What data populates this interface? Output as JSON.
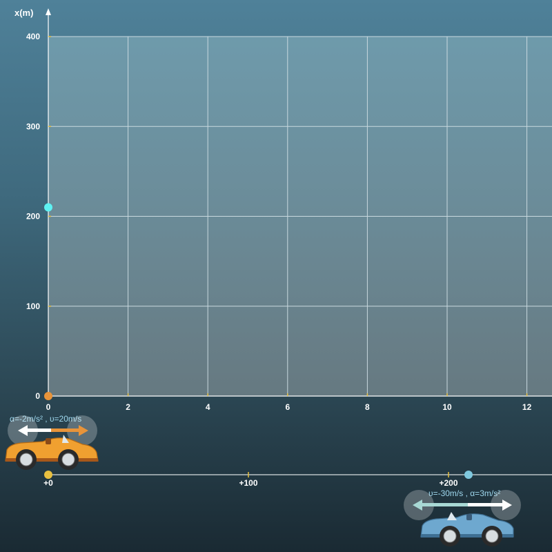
{
  "chart_data": {
    "type": "line",
    "ylabel": "x(m)",
    "xlabel": "",
    "xlim": [
      0,
      12
    ],
    "ylim": [
      0,
      400
    ],
    "x_ticks": [
      "0",
      "2",
      "4",
      "6",
      "8",
      "10",
      "12"
    ],
    "y_ticks": [
      "0",
      "100",
      "200",
      "300",
      "400"
    ],
    "series": [
      {
        "color": "#e8943a",
        "points": [
          [
            0,
            0
          ]
        ]
      },
      {
        "color": "#5ef2f2",
        "points": [
          [
            0,
            210
          ]
        ]
      }
    ]
  },
  "track": {
    "ticks": [
      "+0",
      "+100",
      "+200"
    ]
  },
  "cars": [
    {
      "params_label": "α=-2m/s² , υ=20m/s",
      "color": "#f0a030",
      "marker_color": "#e8c040",
      "position": 0
    },
    {
      "params_label": "υ=-30m/s , α=3m/s²",
      "color": "#6ea8cf",
      "marker_color": "#7fc8de",
      "position": 210
    }
  ],
  "colors": {
    "plot_bg": "#7fa6b4",
    "grid": "#c9d9df",
    "axis": "#ffffff",
    "track_line": "#d8dde0"
  }
}
